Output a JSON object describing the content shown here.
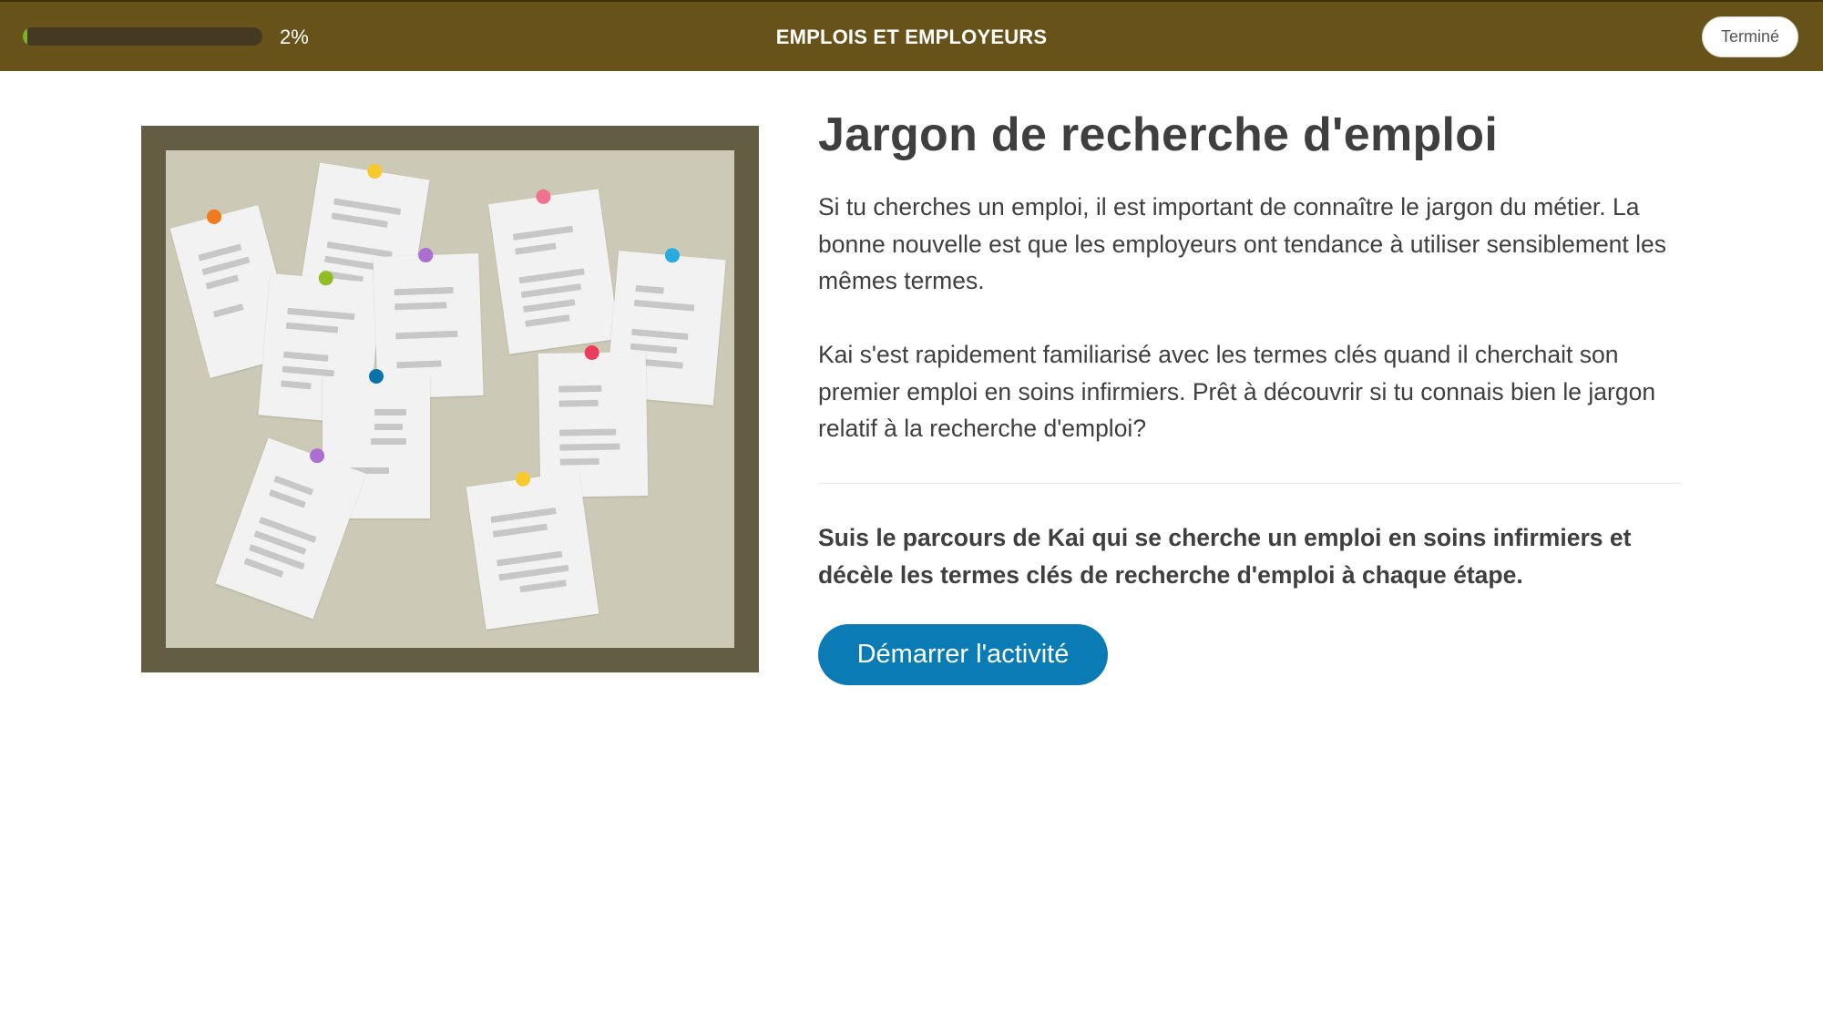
{
  "header": {
    "progress_percent": 2,
    "progress_label": "2%",
    "course_title": "EMPLOIS ET EMPLOYEURS",
    "done_label": "Terminé",
    "bar_color": "#675319",
    "progress_color": "#77b52a"
  },
  "illustration": {
    "icon": "bulletin-board-icon",
    "pin_colors": [
      "#f07a1e",
      "#f8c92c",
      "#8fbf25",
      "#aa6fd1",
      "#0a72a8",
      "#f0728f",
      "#2aabe0",
      "#ec3d5d",
      "#aa6fd1",
      "#f8c92c"
    ]
  },
  "content": {
    "title": "Jargon de recherche d'emploi",
    "paragraph1": "Si tu cherches un emploi, il est important de connaître le jargon du métier. La bonne nouvelle est que les employeurs ont tendance à utiliser sensiblement les mêmes termes.",
    "paragraph2": "Kai s'est rapidement familiarisé avec les termes clés quand il cherchait son premier emploi en soins infirmiers. Prêt à découvrir si tu connais bien le jargon relatif à la recherche d'emploi?",
    "call_to_action": "Suis le parcours de Kai qui se cherche un emploi en soins infirmiers et décèle les termes clés de recherche d'emploi à chaque étape.",
    "start_label": "Démarrer l'activité",
    "button_color": "#0b7bb5"
  }
}
